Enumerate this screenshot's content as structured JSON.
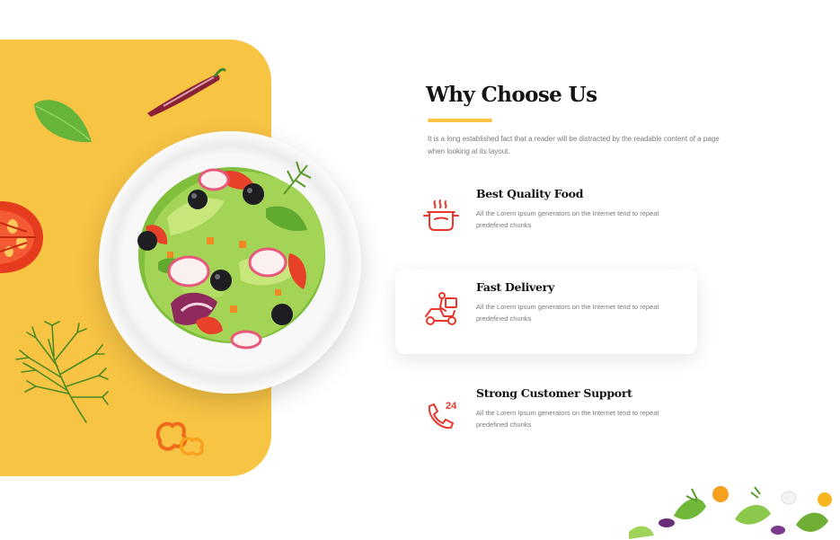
{
  "section": {
    "title": "Why Choose Us",
    "intro": "It is a long established fact that a reader will be distracted by the readable content of a page when looking at its layout.",
    "accent_color": "#f8c444",
    "icon_color": "#e8372c"
  },
  "features": [
    {
      "title": "Best Quality Food",
      "text": "All the Lorem Ipsum generators on the Internet tend to repeat predefined chunks",
      "icon": "cooking-pot-icon"
    },
    {
      "title": "Fast Delivery",
      "text": "All the Lorem Ipsum generators on the Internet tend to repeat predefined chunks",
      "icon": "delivery-scooter-icon"
    },
    {
      "title": "Strong Customer Support",
      "text": "All the Lorem Ipsum generators on the Internet tend to repeat predefined chunks",
      "icon": "phone-24-icon"
    }
  ]
}
